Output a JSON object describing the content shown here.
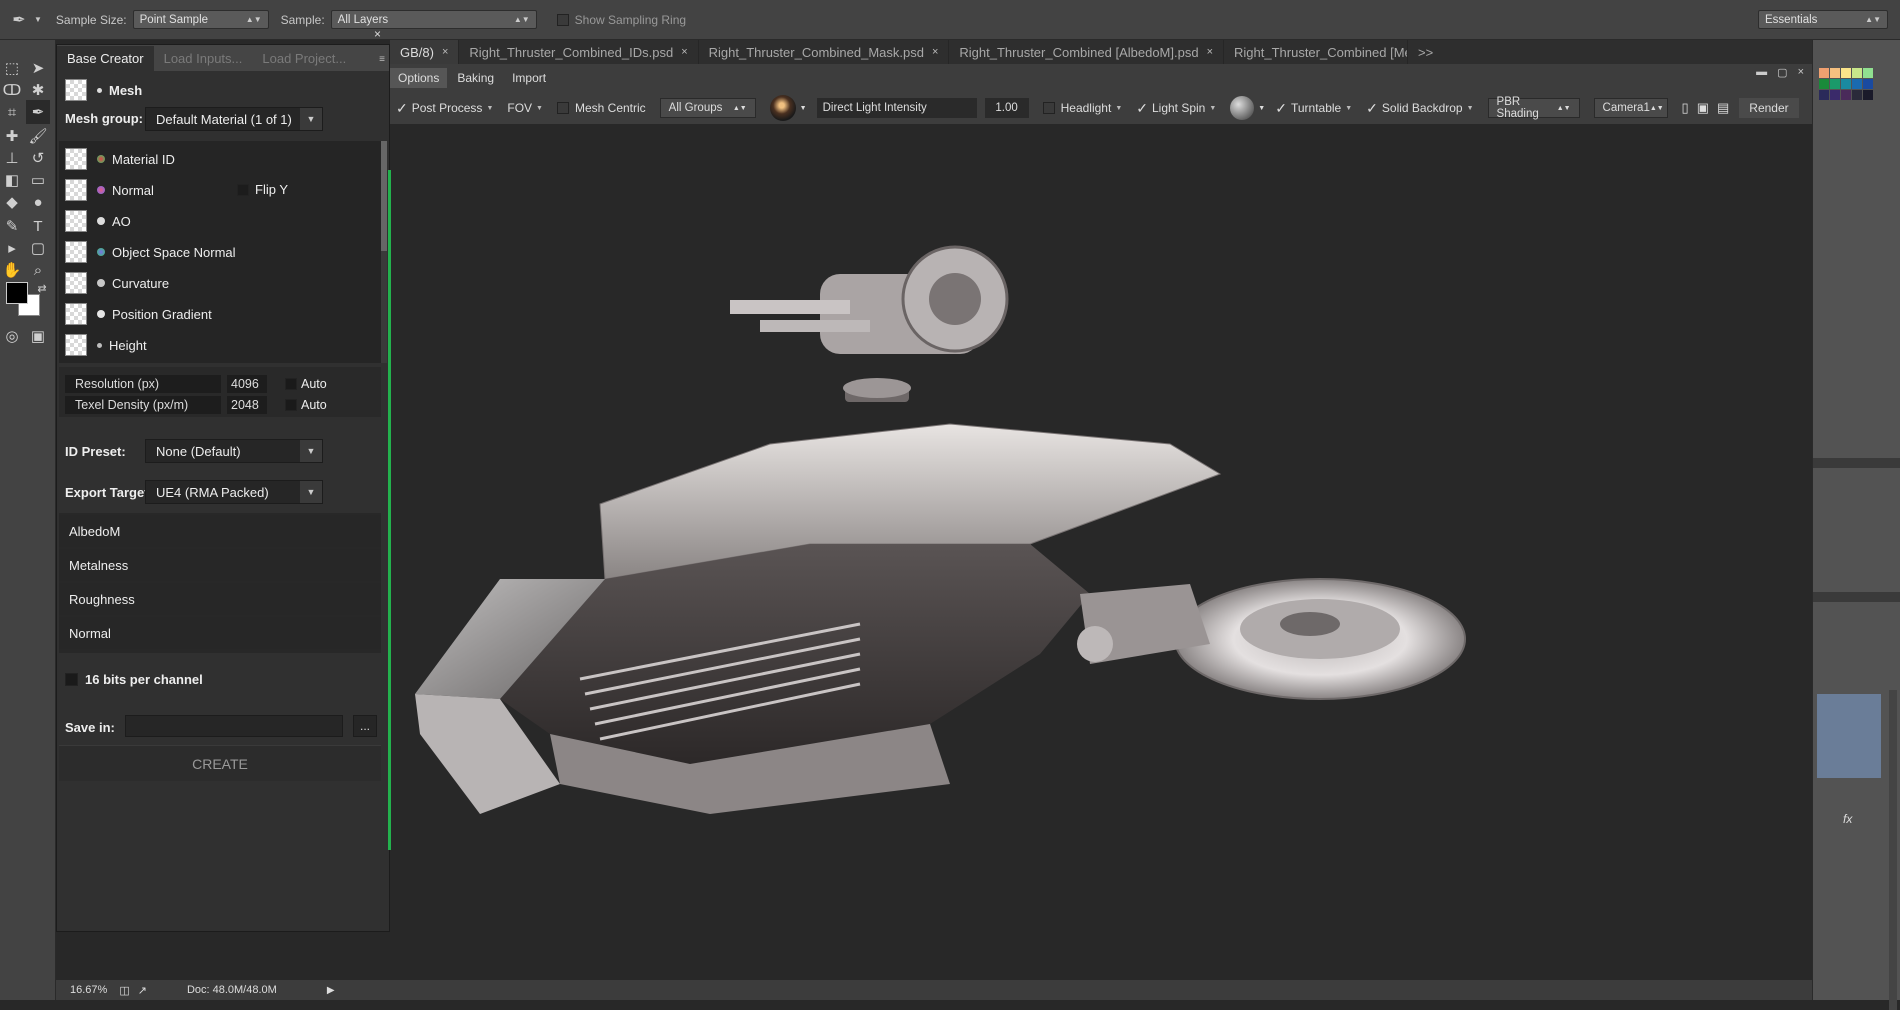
{
  "options_bar": {
    "sample_size_label": "Sample Size:",
    "sample_size_value": "Point Sample",
    "sample_label": "Sample:",
    "sample_value": "All Layers",
    "show_sampling_ring": "Show Sampling Ring",
    "workspace": "Essentials"
  },
  "doc_tabs": [
    {
      "label": "GB/8)"
    },
    {
      "label": "Right_Thruster_Combined_IDs.psd"
    },
    {
      "label": "Right_Thruster_Combined_Mask.psd"
    },
    {
      "label": "Right_Thruster_Combined [AlbedoM].psd"
    },
    {
      "label": "Right_Thruster_Combined [Met"
    }
  ],
  "doc_tabs_overflow": ">>",
  "viewer": {
    "tabs": [
      "Options",
      "Baking",
      "Import"
    ],
    "post_process": "Post Process",
    "fov": "FOV",
    "mesh_centric": "Mesh Centric",
    "groups": "All Groups",
    "light_label": "Direct Light Intensity",
    "light_value": "1.00",
    "headlight": "Headlight",
    "light_spin": "Light Spin",
    "turntable": "Turntable",
    "solid_backdrop": "Solid Backdrop",
    "shading": "PBR Shading",
    "camera": "Camera1",
    "render": "Render"
  },
  "base_creator": {
    "tabs": [
      "Base Creator",
      "Load Inputs...",
      "Load Project..."
    ],
    "mesh": "Mesh",
    "mesh_group_label": "Mesh group:",
    "mesh_group_value": "Default Material (1 of 1)",
    "maps": [
      {
        "label": "Material ID",
        "dot": "#e04545"
      },
      {
        "label": "Normal",
        "dot": "#7a6ee8"
      },
      {
        "label": "AO",
        "dot": "#dddddd"
      },
      {
        "label": "Object Space Normal",
        "dot": "#35c86a"
      },
      {
        "label": "Curvature",
        "dot": "#c8c8c8"
      },
      {
        "label": "Position Gradient",
        "dot": "#e6e6e6"
      },
      {
        "label": "Height",
        "dot": "#bdbdbd"
      }
    ],
    "flip_y": "Flip Y",
    "resolution_label": "Resolution (px)",
    "resolution_value": "4096",
    "texel_label": "Texel Density (px/m)",
    "texel_value": "2048",
    "auto": "Auto",
    "id_preset_label": "ID Preset:",
    "id_preset_value": "None (Default)",
    "export_target_label": "Export Target:",
    "export_target_value": "UE4 (RMA Packed)",
    "export_items": [
      "AlbedoM",
      "Metalness",
      "Roughness",
      "Normal"
    ],
    "bits_label": "16 bits per channel",
    "save_in_label": "Save in:",
    "browse": "...",
    "create": "CREATE"
  },
  "status": {
    "zoom": "16.67%",
    "doc": "Doc: 48.0M/48.0M"
  },
  "swatches": [
    "#f0a070",
    "#f5c080",
    "#fae48a",
    "#c8e68a",
    "#90e090",
    "#1a8a3a",
    "#1a9a6a",
    "#1a8aa0",
    "#1a6ab0",
    "#1a4aa0",
    "#2a2a5a",
    "#3a2a6a",
    "#4a2a5a",
    "#2a2a3a",
    "#1a1a2a"
  ],
  "accent_color": "#23b14d"
}
